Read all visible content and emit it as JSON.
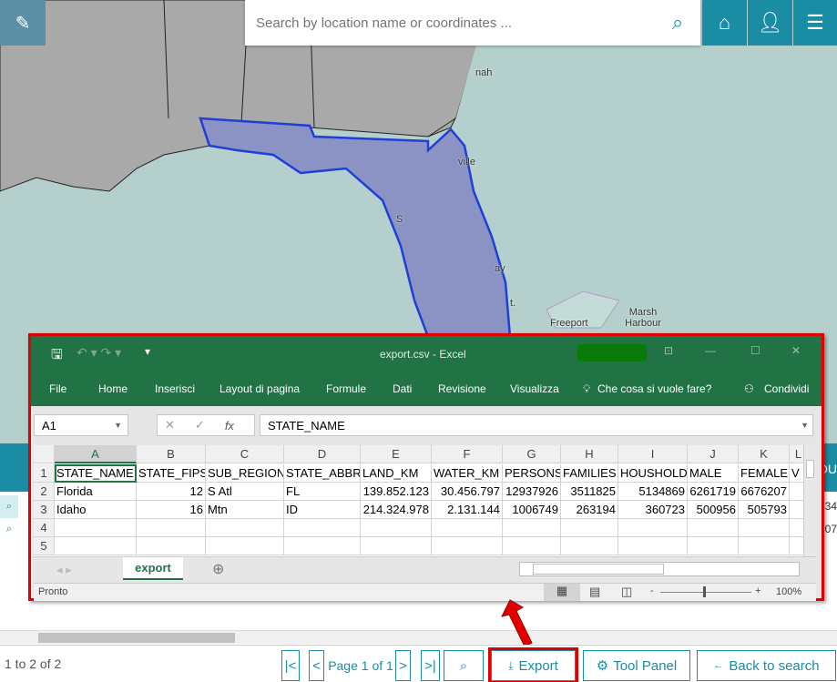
{
  "map": {
    "labels": [
      "nah",
      "ville",
      "S",
      "ay",
      "t.",
      "Freeport",
      "Marsh Harbour"
    ],
    "colors": {
      "water": "#b5d0cc",
      "land": "#a9a9a9",
      "selection_fill": "#8a93c4",
      "selection_stroke": "#1f3fd8"
    }
  },
  "toolbar": {
    "edit_icon": "pencil-icon",
    "search_placeholder": "Search by location name or coordinates ...",
    "search_icon": "search-icon",
    "home_icon": "home-icon",
    "user_icon": "user-icon",
    "menu_icon": "hamburger-icon"
  },
  "excel": {
    "title": "export.csv  -  Excel",
    "ribbon": [
      "File",
      "Home",
      "Inserisci",
      "Layout di pagina",
      "Formule",
      "Dati",
      "Revisione",
      "Visualizza"
    ],
    "tell_me": "Che cosa si vuole fare?",
    "share": "Condividi",
    "name_box": "A1",
    "fx": "fx",
    "formula": "STATE_NAME",
    "columns": [
      "A",
      "B",
      "C",
      "D",
      "E",
      "F",
      "G",
      "H",
      "I",
      "J",
      "K",
      "L"
    ],
    "row_numbers": [
      "1",
      "2",
      "3",
      "4",
      "5"
    ],
    "rows": [
      [
        "STATE_NAME",
        "STATE_FIPS",
        "SUB_REGION",
        "STATE_ABBR",
        "LAND_KM",
        "WATER_KM",
        "PERSONS",
        "FAMILIES",
        "HOUSHOLD",
        "MALE",
        "FEMALE",
        "V"
      ],
      [
        "Florida",
        "12",
        "S Atl",
        "FL",
        "139.852.123",
        "30.456.797",
        "12937926",
        "3511825",
        "5134869",
        "6261719",
        "6676207",
        ""
      ],
      [
        "Idaho",
        "16",
        "Mtn",
        "ID",
        "214.324.978",
        "2.131.144",
        "1006749",
        "263194",
        "360723",
        "500956",
        "505793",
        ""
      ],
      [
        "",
        "",
        "",
        "",
        "",
        "",
        "",
        "",
        "",
        "",
        "",
        ""
      ],
      [
        "",
        "",
        "",
        "",
        "",
        "",
        "",
        "",
        "",
        "",
        "",
        ""
      ]
    ],
    "sheet_tab": "export",
    "status": "Pronto",
    "zoom": "100%",
    "accent": "#217346"
  },
  "table": {
    "bg_cells": [
      "34",
      "07"
    ]
  },
  "footer": {
    "count": "1 to 2 of 2",
    "first": "|<",
    "prev": "<",
    "page": "Page 1 of 1",
    "next": ">",
    "last": ">|",
    "export": "Export",
    "tool_panel": "Tool Panel",
    "back": "Back to search"
  }
}
